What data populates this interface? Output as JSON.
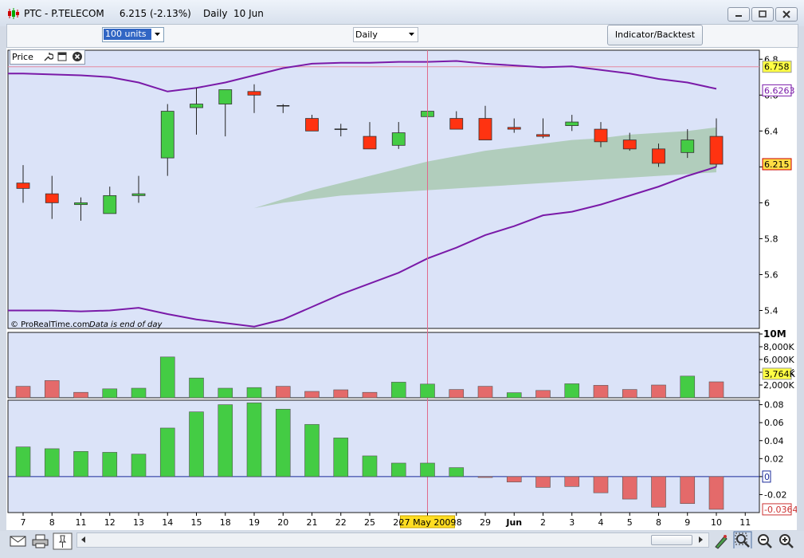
{
  "window": {
    "title": "PTC - P.TELECOM     6.215 (-2.13%)    Daily  10 Jun",
    "colors": {
      "titlebar": "#dbe3ef",
      "chart_bg": "#dbe3f8",
      "accent": "#3166c4"
    }
  },
  "toolbar": {
    "units_value": "100 units",
    "period_value": "Daily",
    "indicator_button_label": "Indicator/Backtest"
  },
  "price_tab": {
    "label": "Price"
  },
  "copyright": "© ProRealTime.com",
  "data_note": "Data is end of day",
  "price_scale": {
    "ticks": [
      "6.8",
      "6.6",
      "6.4",
      "6.2",
      "6",
      "5.8",
      "5.6",
      "5.4"
    ],
    "badge_upper": "6.758",
    "badge_ma": "6.6263",
    "badge_last": "6.215"
  },
  "volume_scale": {
    "ticks": [
      "10M",
      "8,000K",
      "6,000K",
      "4,000K",
      "2,000K"
    ],
    "badge_last": "3,764K"
  },
  "osc_scale": {
    "ticks": [
      "0.08",
      "0.06",
      "0.04",
      "0.02",
      "0",
      "-0.02"
    ],
    "badge_zero": "0",
    "badge_last": "-0.0364"
  },
  "x_axis": {
    "labels": [
      "7",
      "8",
      "11",
      "12",
      "13",
      "14",
      "15",
      "18",
      "19",
      "20",
      "21",
      "22",
      "25",
      "26",
      "27",
      "28",
      "29",
      "Jun",
      "2",
      "3",
      "4",
      "5",
      "8",
      "9",
      "10",
      "11"
    ],
    "cursor_label": "27 May 2009"
  },
  "chart_data": [
    {
      "type": "candlestick",
      "title": "Price",
      "ylim": [
        5.3,
        6.85
      ],
      "categories": [
        "7",
        "8",
        "11",
        "12",
        "13",
        "14",
        "15",
        "18",
        "19",
        "20",
        "21",
        "22",
        "25",
        "26",
        "27",
        "28",
        "29",
        "1",
        "2",
        "3",
        "4",
        "5",
        "8",
        "9",
        "10"
      ],
      "open": [
        6.11,
        6.05,
        5.99,
        5.94,
        6.04,
        6.25,
        6.53,
        6.55,
        6.62,
        6.54,
        6.47,
        6.41,
        6.37,
        6.32,
        6.48,
        6.47,
        6.47,
        6.42,
        6.38,
        6.43,
        6.41,
        6.35,
        6.3,
        6.28,
        6.37
      ],
      "high": [
        6.21,
        6.15,
        6.03,
        6.09,
        6.15,
        6.55,
        6.64,
        6.63,
        6.66,
        6.55,
        6.49,
        6.44,
        6.45,
        6.45,
        6.56,
        6.51,
        6.54,
        6.47,
        6.47,
        6.49,
        6.45,
        6.39,
        6.33,
        6.41,
        6.47
      ],
      "low": [
        6.0,
        5.91,
        5.9,
        5.94,
        6.0,
        6.15,
        6.38,
        6.37,
        6.5,
        6.5,
        6.4,
        6.37,
        6.3,
        6.3,
        6.46,
        6.41,
        6.35,
        6.39,
        6.36,
        6.4,
        6.31,
        6.29,
        6.2,
        6.25,
        6.2
      ],
      "close": [
        6.08,
        6.0,
        6.0,
        6.04,
        6.05,
        6.51,
        6.55,
        6.63,
        6.6,
        6.54,
        6.4,
        6.41,
        6.3,
        6.39,
        6.51,
        6.41,
        6.35,
        6.41,
        6.37,
        6.45,
        6.34,
        6.3,
        6.22,
        6.35,
        6.215
      ],
      "bollinger_upper": [
        6.72,
        6.715,
        6.71,
        6.7,
        6.67,
        6.62,
        6.64,
        6.67,
        6.71,
        6.75,
        6.775,
        6.78,
        6.78,
        6.785,
        6.785,
        6.79,
        6.775,
        6.765,
        6.755,
        6.76,
        6.74,
        6.72,
        6.69,
        6.67,
        6.635
      ],
      "bollinger_lower": [
        5.4,
        5.4,
        5.395,
        5.4,
        5.415,
        5.38,
        5.35,
        5.33,
        5.31,
        5.35,
        5.42,
        5.49,
        5.55,
        5.61,
        5.69,
        5.75,
        5.82,
        5.87,
        5.93,
        5.95,
        5.99,
        6.04,
        6.09,
        6.15,
        6.2
      ],
      "cloud_top": [
        5.96,
        5.955,
        5.95,
        5.945,
        5.935,
        5.94,
        5.95,
        5.96,
        5.97,
        6.02,
        6.07,
        6.11,
        6.15,
        6.19,
        6.23,
        6.26,
        6.29,
        6.31,
        6.33,
        6.35,
        6.36,
        6.38,
        6.39,
        6.4,
        6.42
      ],
      "cloud_bottom": [
        5.96,
        5.955,
        5.95,
        5.945,
        5.935,
        5.94,
        5.95,
        5.96,
        5.97,
        6.0,
        6.02,
        6.04,
        6.05,
        6.06,
        6.07,
        6.08,
        6.09,
        6.1,
        6.11,
        6.12,
        6.13,
        6.14,
        6.15,
        6.16,
        6.17
      ],
      "colors": {
        "up": "#44cc44",
        "down": "#ff3311",
        "bands": "#7a1aa8",
        "cloud": "#a9c9b1"
      },
      "cursor_category": "27"
    },
    {
      "type": "bar",
      "title": "Volume",
      "ylim": [
        0,
        10000
      ],
      "values": [
        1800,
        2700,
        850,
        1400,
        1500,
        6400,
        3100,
        1500,
        1600,
        1800,
        1000,
        1250,
        850,
        2450,
        2150,
        1300,
        1800,
        800,
        1150,
        2200,
        1950,
        1300,
        2000,
        3400,
        2500
      ],
      "directions": [
        "down",
        "down",
        "down",
        "up",
        "up",
        "up",
        "up",
        "up",
        "up",
        "down",
        "down",
        "down",
        "down",
        "up",
        "up",
        "down",
        "down",
        "up",
        "down",
        "up",
        "down",
        "down",
        "down",
        "up",
        "down"
      ],
      "unit": "K"
    },
    {
      "type": "bar",
      "title": "Oscillator",
      "ylim": [
        -0.04,
        0.085
      ],
      "values": [
        0.033,
        0.031,
        0.028,
        0.027,
        0.025,
        0.054,
        0.072,
        0.08,
        0.082,
        0.075,
        0.058,
        0.043,
        0.023,
        0.015,
        0.015,
        0.01,
        -0.001,
        -0.006,
        -0.012,
        -0.011,
        -0.018,
        -0.025,
        -0.034,
        -0.03,
        -0.0364
      ]
    }
  ],
  "icons": [
    "print-icon",
    "mail-icon",
    "pin-icon",
    "wrench-icon",
    "window-icon",
    "close-icon",
    "zoom-out-icon",
    "zoom-in-icon",
    "zoom-select-icon",
    "draw-icon"
  ]
}
